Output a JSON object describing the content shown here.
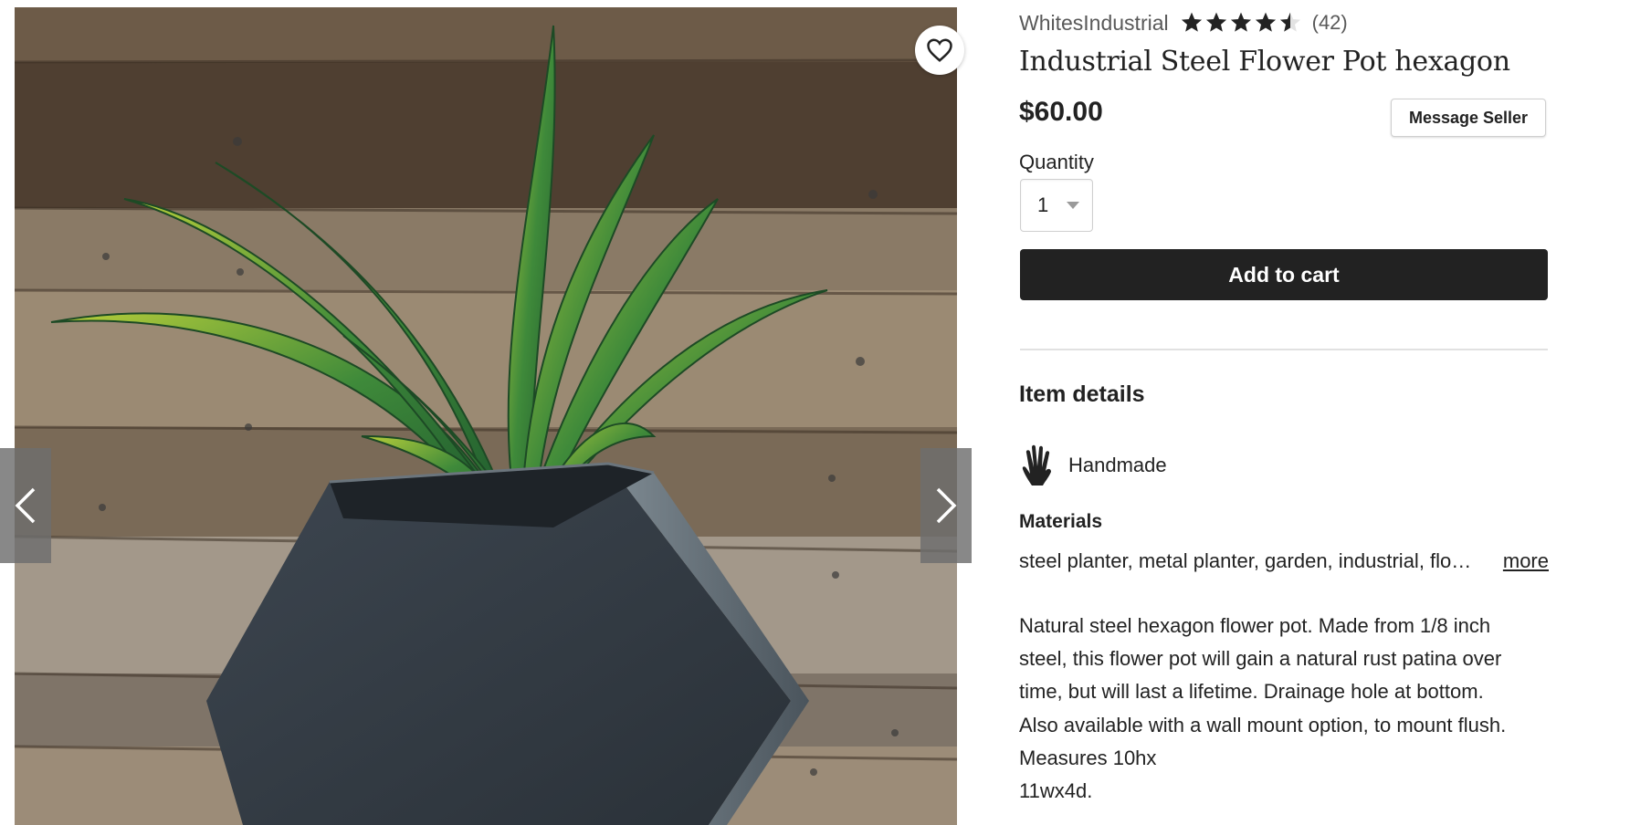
{
  "listing": {
    "shop_name": "WhitesIndustrial",
    "rating": 4.5,
    "rating_max": 5,
    "review_count": "(42)",
    "title": "Industrial Steel Flower Pot hexagon",
    "price": "$60.00",
    "message_seller_label": "Message Seller"
  },
  "quantity": {
    "label": "Quantity",
    "selected": "1"
  },
  "cart": {
    "add_label": "Add to cart"
  },
  "details": {
    "heading": "Item details",
    "handmade_label": "Handmade",
    "materials_heading": "Materials",
    "materials_text": "steel planter, metal planter, garden, industrial, flo…",
    "more_label": "more",
    "description_lines": [
      "Natural steel hexagon flower pot. Made from 1/8 inch",
      "steel, this flower pot will gain a natural rust patina over",
      "time, but will last a lifetime. Drainage hole at bottom.",
      "Also available with a wall mount option, to mount flush.",
      "Measures 10hx",
      "11wx4d."
    ]
  },
  "gallery": {
    "prev_icon": "chevron-left-icon",
    "next_icon": "chevron-right-icon",
    "favorite_icon": "heart-outline-icon"
  },
  "colors": {
    "text": "#222222",
    "muted": "#595959",
    "button_dark": "#222222",
    "border": "#cfcfcf"
  }
}
